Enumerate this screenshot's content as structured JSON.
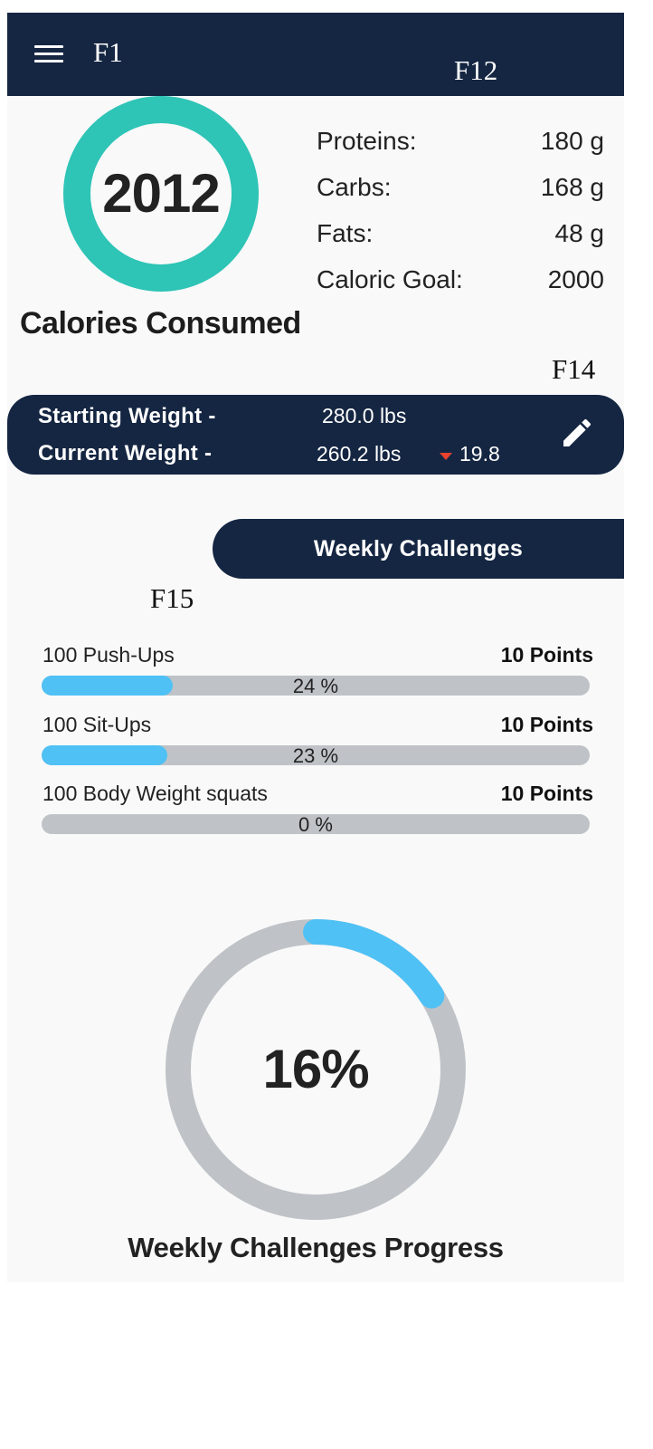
{
  "figure_labels": {
    "f1": "F1",
    "f12": "F12",
    "f14": "F14",
    "f15": "F15"
  },
  "header": {
    "menu_icon": "hamburger-menu-icon"
  },
  "calories": {
    "value": "2012",
    "caption": "Calories Consumed",
    "ring_color": "#2ec4b6"
  },
  "macros": [
    {
      "label": "Proteins:",
      "value": "180 g"
    },
    {
      "label": "Carbs:",
      "value": "168 g"
    },
    {
      "label": "Fats:",
      "value": "48 g"
    },
    {
      "label": "Caloric Goal:",
      "value": "2000"
    }
  ],
  "weight": {
    "starting_label": "Starting Weight -",
    "starting_value": "280.0 lbs",
    "current_label": "Current Weight -",
    "current_value": "260.2 lbs",
    "delta": "19.8",
    "delta_icon": "down-triangle-icon",
    "edit_icon": "pencil-edit-icon"
  },
  "weekly_tab_label": "Weekly Challenges",
  "challenges": [
    {
      "name": "100 Push-Ups",
      "points": "10 Points",
      "percent": 24,
      "percent_label": "24 %"
    },
    {
      "name": "100 Sit-Ups",
      "points": "10 Points",
      "percent": 23,
      "percent_label": "23 %"
    },
    {
      "name": "100 Body Weight squats",
      "points": "10 Points",
      "percent": 0,
      "percent_label": "0 %"
    }
  ],
  "weekly_progress": {
    "percent": 16,
    "label": "16%",
    "caption": "Weekly Challenges Progress"
  },
  "colors": {
    "navy": "#152642",
    "teal": "#2ec4b6",
    "progress_blue": "#4fc1f5",
    "track_gray": "#bfc3c7",
    "delta_red": "#e8422f"
  }
}
